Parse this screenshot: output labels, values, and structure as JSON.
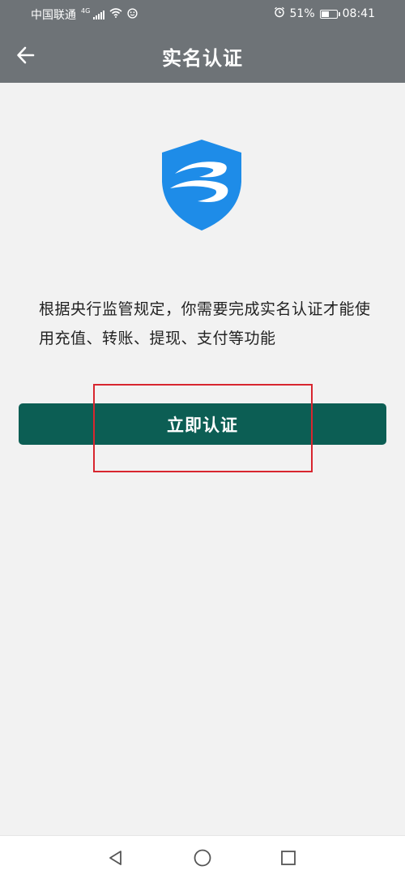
{
  "status_bar": {
    "carrier": "中国联通",
    "network": "4G",
    "battery": "51%",
    "battery_level": 0.51,
    "time": "08:41",
    "icons": [
      "signal-icon",
      "wifi-icon",
      "smiley-icon",
      "alarm-icon",
      "battery-icon"
    ]
  },
  "app_bar": {
    "title": "实名认证",
    "back_icon": "arrow-left-icon"
  },
  "main": {
    "logo_icon": "shield-logo-icon",
    "description": "根据央行监管规定，你需要完成实名认证才能使用充值、转账、提现、支付等功能",
    "verify_button_label": "立即认证"
  },
  "nav_bar": {
    "icons": [
      "back-triangle-icon",
      "home-circle-icon",
      "recents-square-icon"
    ]
  },
  "colors": {
    "top_bar": "#6e7377",
    "background": "#f2f2f2",
    "button": "#0c5e54",
    "logo_blue": "#1e8ce8",
    "highlight_red": "#d8262f"
  }
}
